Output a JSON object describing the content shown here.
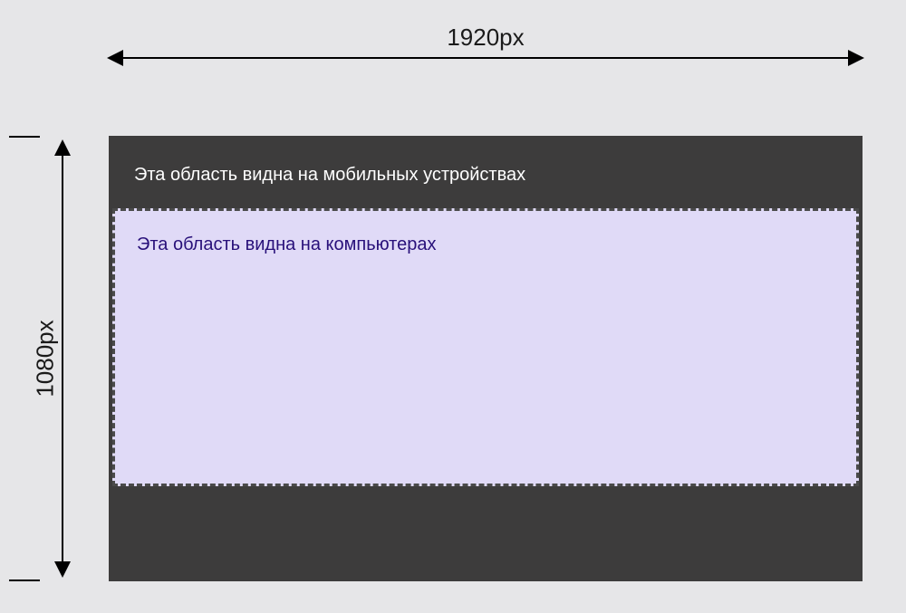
{
  "dimensions": {
    "width_label": "1920px",
    "height_label": "1080px"
  },
  "regions": {
    "mobile_text": "Эта область видна на мобильных устройствах",
    "desktop_text": "Эта область видна на компьютерах"
  },
  "colors": {
    "background": "#e6e6e8",
    "frame_bg": "#3d3c3c",
    "desktop_bg": "#e0daf7",
    "desktop_border": "#4a4a4a",
    "mobile_text_color": "#ffffff",
    "desktop_text_color": "#28107a"
  }
}
